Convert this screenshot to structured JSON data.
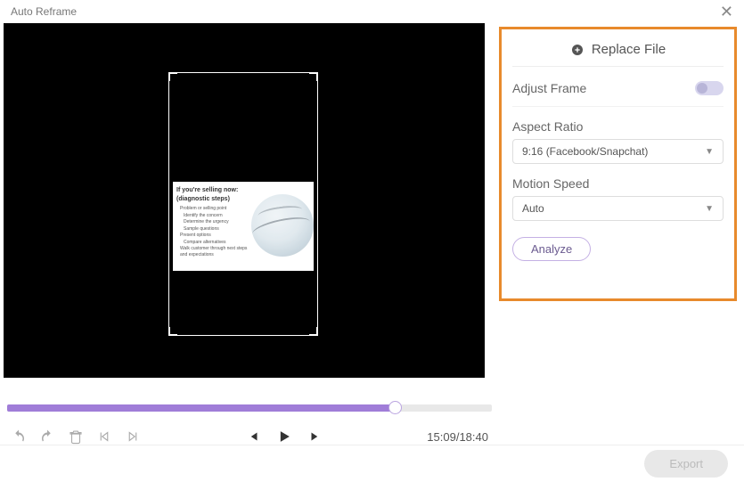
{
  "titlebar": {
    "title": "Auto Reframe"
  },
  "preview": {
    "slide_heading1": "If you're selling now:",
    "slide_heading2": "(diagnostic steps)",
    "bullet1": "Problem or selling point",
    "bullet2a": "Identify the concern",
    "bullet2b": "Determine the urgency",
    "bullet2c": "Sample questions",
    "bullet3a": "Present options",
    "bullet3b": "Compare alternatives",
    "bullet4": "Walk customer through next steps and expectations"
  },
  "timeline": {
    "current": "15:09",
    "total": "18:40"
  },
  "panel": {
    "replace_label": "Replace File",
    "adjust_frame": {
      "label": "Adjust Frame",
      "on": false
    },
    "aspect_ratio": {
      "label": "Aspect Ratio",
      "value": "9:16 (Facebook/Snapchat)"
    },
    "motion_speed": {
      "label": "Motion Speed",
      "value": "Auto"
    },
    "analyze_label": "Analyze"
  },
  "footer": {
    "export_label": "Export"
  }
}
